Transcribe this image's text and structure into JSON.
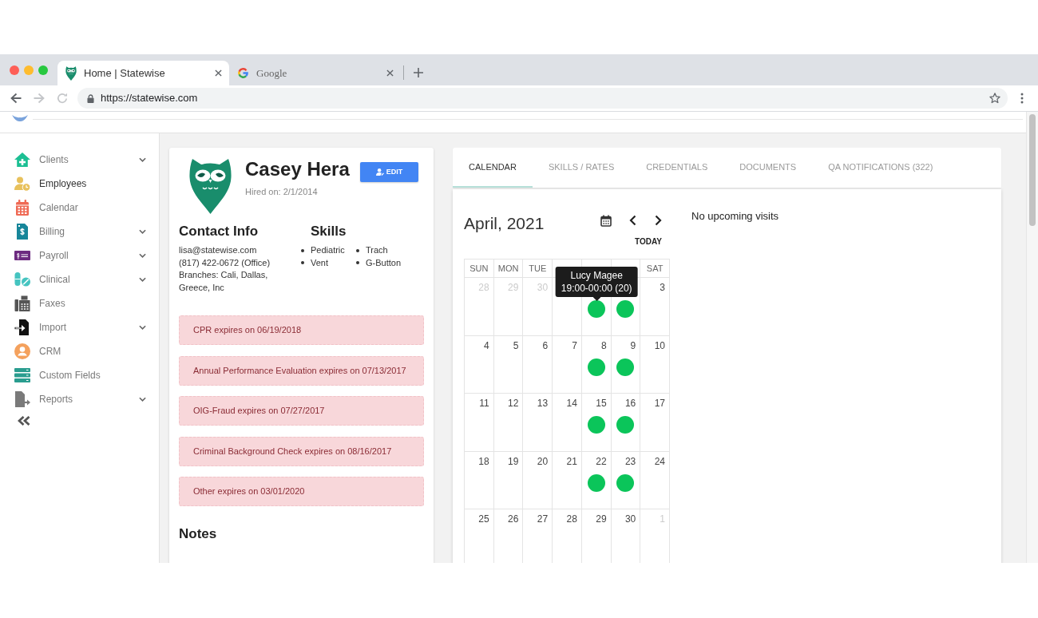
{
  "browser": {
    "tabs": [
      {
        "kind": "owl",
        "title": "Home | Statewise",
        "selected": true
      },
      {
        "kind": "g-logo",
        "title": "Google",
        "selected": false
      }
    ],
    "url": "https://statewise.com"
  },
  "sidebar": {
    "items": [
      {
        "kind": "house",
        "label": "Clients",
        "expandable": true,
        "selected": false
      },
      {
        "kind": "person-clock",
        "label": "Employees",
        "expandable": false,
        "selected": true
      },
      {
        "kind": "calendar",
        "label": "Calendar",
        "expandable": false,
        "selected": false
      },
      {
        "kind": "bill",
        "label": "Billing",
        "expandable": true,
        "selected": false
      },
      {
        "kind": "pay-card",
        "label": "Payroll",
        "expandable": true,
        "selected": false
      },
      {
        "kind": "pills",
        "label": "Clinical",
        "expandable": true,
        "selected": false
      },
      {
        "kind": "fax",
        "label": "Faxes",
        "expandable": false,
        "selected": false
      },
      {
        "kind": "import",
        "label": "Import",
        "expandable": true,
        "selected": false
      },
      {
        "kind": "user-circle",
        "label": "CRM",
        "expandable": false,
        "selected": false
      },
      {
        "kind": "stack",
        "label": "Custom Fields",
        "expandable": false,
        "selected": false
      },
      {
        "kind": "report",
        "label": "Reports",
        "expandable": true,
        "selected": false
      }
    ]
  },
  "profile": {
    "name": "Casey Hera",
    "hired": "Hired on: 2/1/2014",
    "edit_button": "EDIT",
    "contact": {
      "heading": "Contact Info",
      "lines": [
        "lisa@statewise.com",
        "(817) 422-0672 (Office)",
        "Branches: Cali, Dallas, Greece, Inc"
      ]
    },
    "skills": {
      "heading": "Skills",
      "items": [
        "Pediatric",
        "Trach",
        "Vent",
        "G-Button"
      ]
    },
    "alerts": [
      "CPR expires on 06/19/2018",
      "Annual Performance Evaluation expires on 07/13/2017",
      "OIG-Fraud expires on 07/27/2017",
      "Criminal Background Check expires on 08/16/2017",
      "Other expires on 03/01/2020"
    ],
    "notes": {
      "heading": "Notes"
    }
  },
  "tabs": [
    {
      "label": "CALENDAR",
      "selected": true
    },
    {
      "label": "SKILLS / RATES",
      "selected": false
    },
    {
      "label": "CREDENTIALS",
      "selected": false
    },
    {
      "label": "DOCUMENTS",
      "selected": false
    },
    {
      "label": "QA NOTIFICATIONS (322)",
      "selected": false
    }
  ],
  "calendar": {
    "title": "April, 2021",
    "today_button": "TODAY",
    "weekdays_start": [
      "SUN",
      "MON",
      "TUE"
    ],
    "weekdays_end": [
      "SAT"
    ],
    "weeks": [
      [
        {
          "day": "28",
          "in_month": false,
          "visit": false
        },
        {
          "day": "29",
          "in_month": false,
          "visit": false
        },
        {
          "day": "30",
          "in_month": false,
          "visit": false
        },
        {
          "visit": false
        },
        {
          "visit": true,
          "tooltip": {
            "name": "Lucy Magee",
            "time": "19:00-00:00 (20)"
          }
        },
        {
          "visit": true
        },
        {
          "day": "3",
          "in_month": true,
          "visit": false
        }
      ],
      [
        {
          "day": "4",
          "in_month": true,
          "visit": false
        },
        {
          "day": "5",
          "in_month": true,
          "visit": false
        },
        {
          "day": "6",
          "in_month": true,
          "visit": false
        },
        {
          "day": "7",
          "in_month": true,
          "visit": false
        },
        {
          "day": "8",
          "in_month": true,
          "visit": true
        },
        {
          "day": "9",
          "in_month": true,
          "visit": true
        },
        {
          "day": "10",
          "in_month": true,
          "visit": false
        }
      ],
      [
        {
          "day": "11",
          "in_month": true,
          "visit": false
        },
        {
          "day": "12",
          "in_month": true,
          "visit": false
        },
        {
          "day": "13",
          "in_month": true,
          "visit": false
        },
        {
          "day": "14",
          "in_month": true,
          "visit": false
        },
        {
          "day": "15",
          "in_month": true,
          "visit": true
        },
        {
          "day": "16",
          "in_month": true,
          "visit": true
        },
        {
          "day": "17",
          "in_month": true,
          "visit": false
        }
      ],
      [
        {
          "day": "18",
          "in_month": true,
          "visit": false
        },
        {
          "day": "19",
          "in_month": true,
          "visit": false
        },
        {
          "day": "20",
          "in_month": true,
          "visit": false
        },
        {
          "day": "21",
          "in_month": true,
          "visit": false
        },
        {
          "day": "22",
          "in_month": true,
          "visit": true
        },
        {
          "day": "23",
          "in_month": true,
          "visit": true
        },
        {
          "day": "24",
          "in_month": true,
          "visit": false
        }
      ],
      [
        {
          "day": "25",
          "in_month": true,
          "visit": false
        },
        {
          "day": "26",
          "in_month": true,
          "visit": false
        },
        {
          "day": "27",
          "in_month": true,
          "visit": false
        },
        {
          "day": "28",
          "in_month": true,
          "visit": false
        },
        {
          "day": "29",
          "in_month": true,
          "visit": false
        },
        {
          "day": "30",
          "in_month": true,
          "visit": false
        },
        {
          "day": "1",
          "in_month": false,
          "visit": false
        }
      ]
    ],
    "message": "No upcoming visits"
  }
}
